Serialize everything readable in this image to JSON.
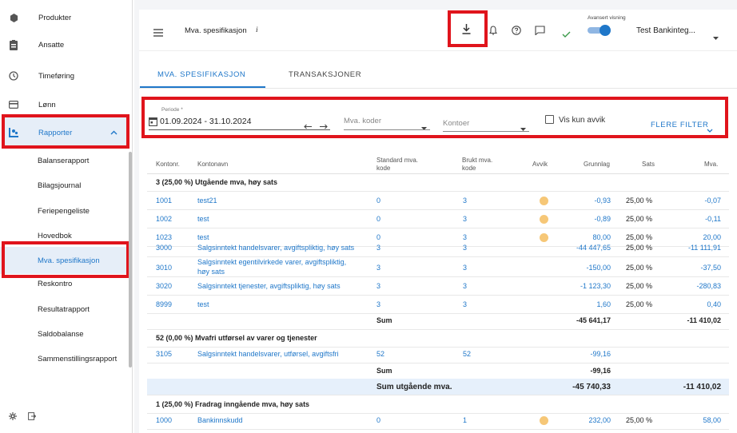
{
  "sidebar": {
    "items": [
      {
        "label": "Produkter",
        "icon": "cube-icon"
      },
      {
        "label": "Ansatte",
        "icon": "badge-icon"
      },
      {
        "label": "Timeføring",
        "icon": "clock-icon"
      },
      {
        "label": "Lønn",
        "icon": "card-icon"
      },
      {
        "label": "Rapporter",
        "icon": "report-icon"
      }
    ],
    "sub_items": [
      "Balanserapport",
      "Bilagsjournal",
      "Feriepengeliste",
      "Hovedbok",
      "Mva. spesifikasjon",
      "Reskontro",
      "Resultatrapport",
      "Saldobalanse",
      "Sammenstillingsrapport"
    ]
  },
  "header": {
    "title": "Mva. spesifikasjon",
    "info": "i",
    "advanced_label": "Avansert visning",
    "company": "Test Bankinteg..."
  },
  "tabs": [
    "MVA. SPESIFIKASJON",
    "TRANSAKSJONER"
  ],
  "filters": {
    "period_label": "Periode *",
    "period_value": "01.09.2024 - 31.10.2024",
    "mva_placeholder": "Mva. koder",
    "kontoer_placeholder": "Kontoer",
    "vis_kun_avvik": "Vis kun avvik",
    "flere_filter": "FLERE FILTER"
  },
  "table": {
    "headers": [
      "Kontonr.",
      "Kontonavn",
      "Standard mva. kode",
      "Brukt mva. kode",
      "Avvik",
      "Grunnlag",
      "Sats",
      "Mva."
    ],
    "groups": [
      {
        "title": "3 (25,00 %) Utgående mva, høy sats"
      },
      {
        "title": "52 (0,00 %) Mvafri utførsel av varer og tjenester"
      },
      {
        "title": "1 (25,00 %) Fradrag inngående mva, høy sats"
      }
    ],
    "rows": [
      {
        "nr": "1001",
        "name": "test21",
        "std": "0",
        "brukt": "3",
        "avvik": true,
        "grunnlag": "-0,93",
        "sats": "25,00 %",
        "mva": "-0,07"
      },
      {
        "nr": "1002",
        "name": "test",
        "std": "0",
        "brukt": "3",
        "avvik": true,
        "grunnlag": "-0,89",
        "sats": "25,00 %",
        "mva": "-0,11"
      },
      {
        "nr": "1023",
        "name": "test",
        "std": "0",
        "brukt": "3",
        "avvik": true,
        "grunnlag": "80,00",
        "sats": "25,00 %",
        "mva": "20,00"
      },
      {
        "nr": "3000",
        "name": "Salgsinntekt handelsvarer, avgiftspliktig, høy sats",
        "std": "3",
        "brukt": "3",
        "avvik": false,
        "grunnlag": "-44 447,65",
        "sats": "25,00 %",
        "mva": "-11 111,91"
      },
      {
        "nr": "3010",
        "name": "Salgsinntekt egentilvirkede varer, avgiftspliktig,",
        "name2": "høy sats",
        "std": "3",
        "brukt": "3",
        "avvik": false,
        "grunnlag": "-150,00",
        "sats": "25,00 %",
        "mva": "-37,50"
      },
      {
        "nr": "3020",
        "name": "Salgsinntekt tjenester, avgiftspliktig, høy sats",
        "std": "3",
        "brukt": "3",
        "avvik": false,
        "grunnlag": "-1 123,30",
        "sats": "25,00 %",
        "mva": "-280,83"
      },
      {
        "nr": "8999",
        "name": "test",
        "std": "3",
        "brukt": "3",
        "avvik": false,
        "grunnlag": "1,60",
        "sats": "25,00 %",
        "mva": "0,40"
      },
      {
        "nr": "3105",
        "name": "Salgsinntekt handelsvarer, utførsel, avgiftsfri",
        "std": "52",
        "brukt": "52",
        "avvik": false,
        "grunnlag": "-99,16",
        "sats": "",
        "mva": ""
      },
      {
        "nr": "1000",
        "name": "Bankinnskudd",
        "std": "0",
        "brukt": "1",
        "avvik": true,
        "grunnlag": "232,00",
        "sats": "25,00 %",
        "mva": "58,00"
      }
    ],
    "sums": [
      {
        "label": "Sum",
        "grunnlag": "-45 641,17",
        "mva": "-11 410,02"
      },
      {
        "label": "Sum",
        "grunnlag": "-99,16",
        "mva": ""
      },
      {
        "label": "Sum utgående mva.",
        "grunnlag": "-45 740,33",
        "mva": "-11 410,02"
      }
    ]
  },
  "colors": {
    "accent": "#1f77c9",
    "highlight": "#e0141c"
  }
}
